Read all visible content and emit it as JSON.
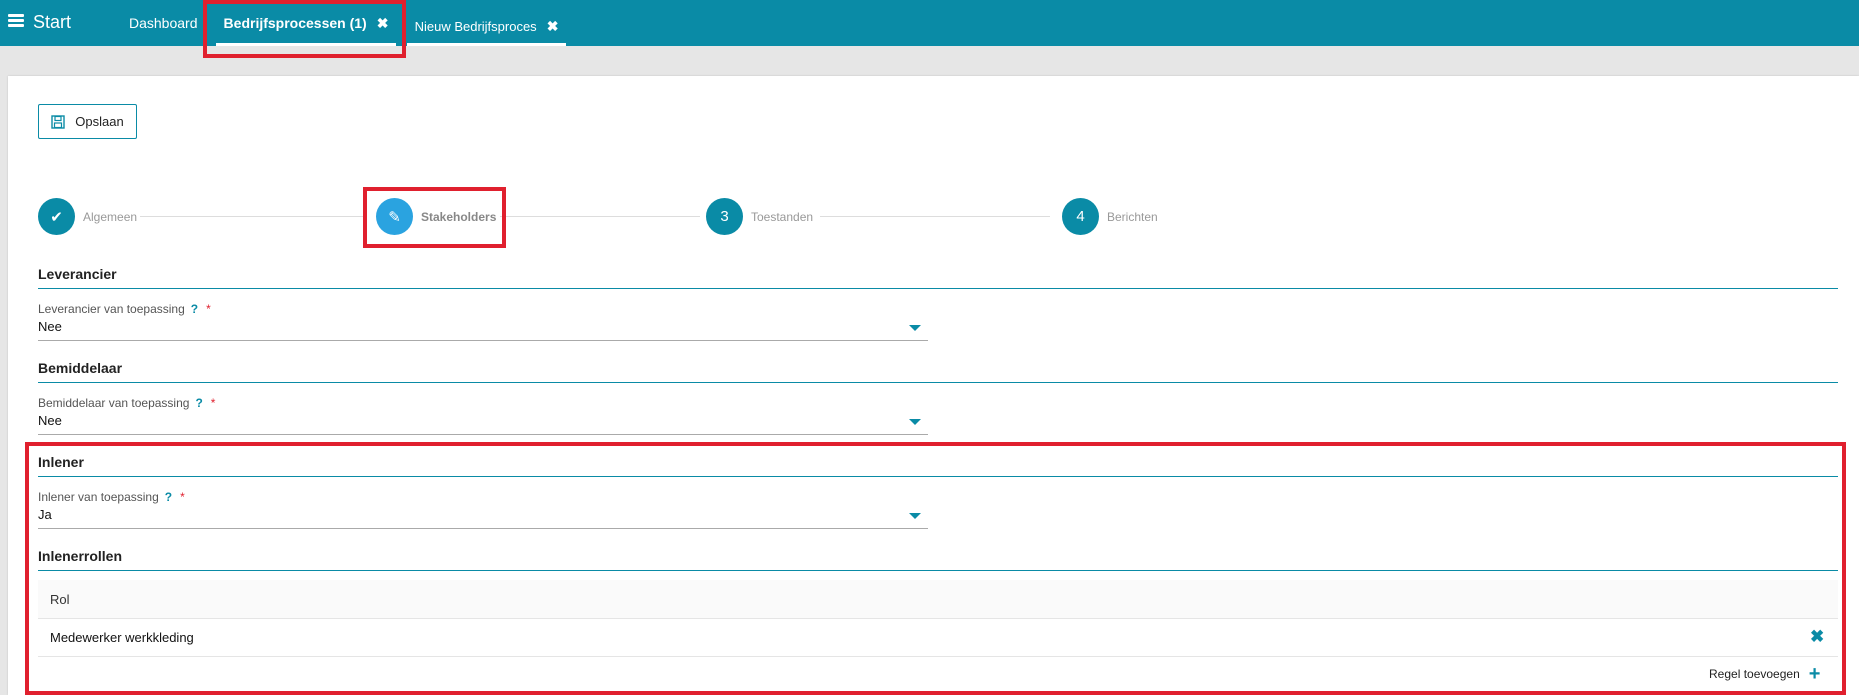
{
  "header": {
    "brand": "Start",
    "tabs": [
      {
        "label": "Dashboard"
      },
      {
        "label": "Bedrijfsprocessen (1)",
        "close_icon": "✖"
      },
      {
        "label": "Nieuw Bedrijfsproces",
        "close_icon": "✖"
      }
    ]
  },
  "toolbar": {
    "save_label": "Opslaan",
    "save_icon": "floppy-disk-icon"
  },
  "steps": [
    {
      "label": "Algemeen",
      "marker": "✔",
      "state": "done"
    },
    {
      "label": "Stakeholders",
      "marker": "✎",
      "state": "active"
    },
    {
      "label": "Toestanden",
      "marker": "3",
      "state": "todo"
    },
    {
      "label": "Berichten",
      "marker": "4",
      "state": "todo"
    }
  ],
  "sections": {
    "leverancier": {
      "title": "Leverancier",
      "field_label": "Leverancier van toepassing",
      "help": "?",
      "required": "*",
      "value": "Nee"
    },
    "bemiddelaar": {
      "title": "Bemiddelaar",
      "field_label": "Bemiddelaar van toepassing",
      "help": "?",
      "required": "*",
      "value": "Nee"
    },
    "inlener": {
      "title": "Inlener",
      "field_label": "Inlener van toepassing",
      "help": "?",
      "required": "*",
      "value": "Ja"
    },
    "inlenerrollen": {
      "title": "Inlenerrollen",
      "column_header": "Rol",
      "rows": [
        {
          "rol": "Medewerker werkkleding",
          "remove_icon": "✖"
        }
      ],
      "add_label": "Regel toevoegen",
      "add_icon": "+"
    }
  },
  "colors": {
    "accent": "#0a8ba6",
    "active_step": "#2aa3e0",
    "highlight": "#e0202e"
  }
}
